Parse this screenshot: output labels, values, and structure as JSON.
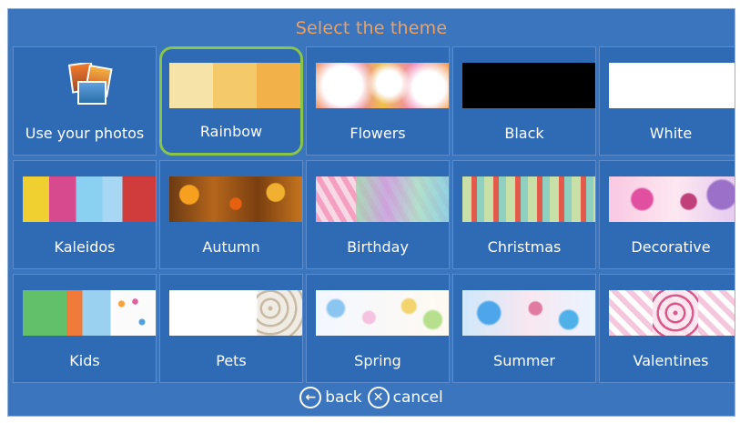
{
  "title": "Select the theme",
  "themes": [
    {
      "label": "Use your photos",
      "name": "use-your-photos"
    },
    {
      "label": "Rainbow",
      "name": "rainbow",
      "selected": true,
      "colors": [
        "#f6e3a8",
        "#f3c96a",
        "#f2b149"
      ]
    },
    {
      "label": "Flowers",
      "name": "flowers"
    },
    {
      "label": "Black",
      "name": "black"
    },
    {
      "label": "White",
      "name": "white"
    },
    {
      "label": "Kaleidos",
      "name": "kaleidos"
    },
    {
      "label": "Autumn",
      "name": "autumn"
    },
    {
      "label": "Birthday",
      "name": "birthday"
    },
    {
      "label": "Christmas",
      "name": "christmas"
    },
    {
      "label": "Decorative",
      "name": "decorative"
    },
    {
      "label": "Kids",
      "name": "kids"
    },
    {
      "label": "Pets",
      "name": "pets"
    },
    {
      "label": "Spring",
      "name": "spring"
    },
    {
      "label": "Summer",
      "name": "summer"
    },
    {
      "label": "Valentines",
      "name": "valentines"
    }
  ],
  "nav": {
    "back_label": "back",
    "cancel_label": "cancel",
    "back_icon": "arrow-left-circle-icon",
    "cancel_icon": "x-circle-icon"
  },
  "colors": {
    "title": "#f3a05c",
    "background": "#3a75be",
    "tile": "#2f6ab4",
    "selection": "#89c54a"
  }
}
